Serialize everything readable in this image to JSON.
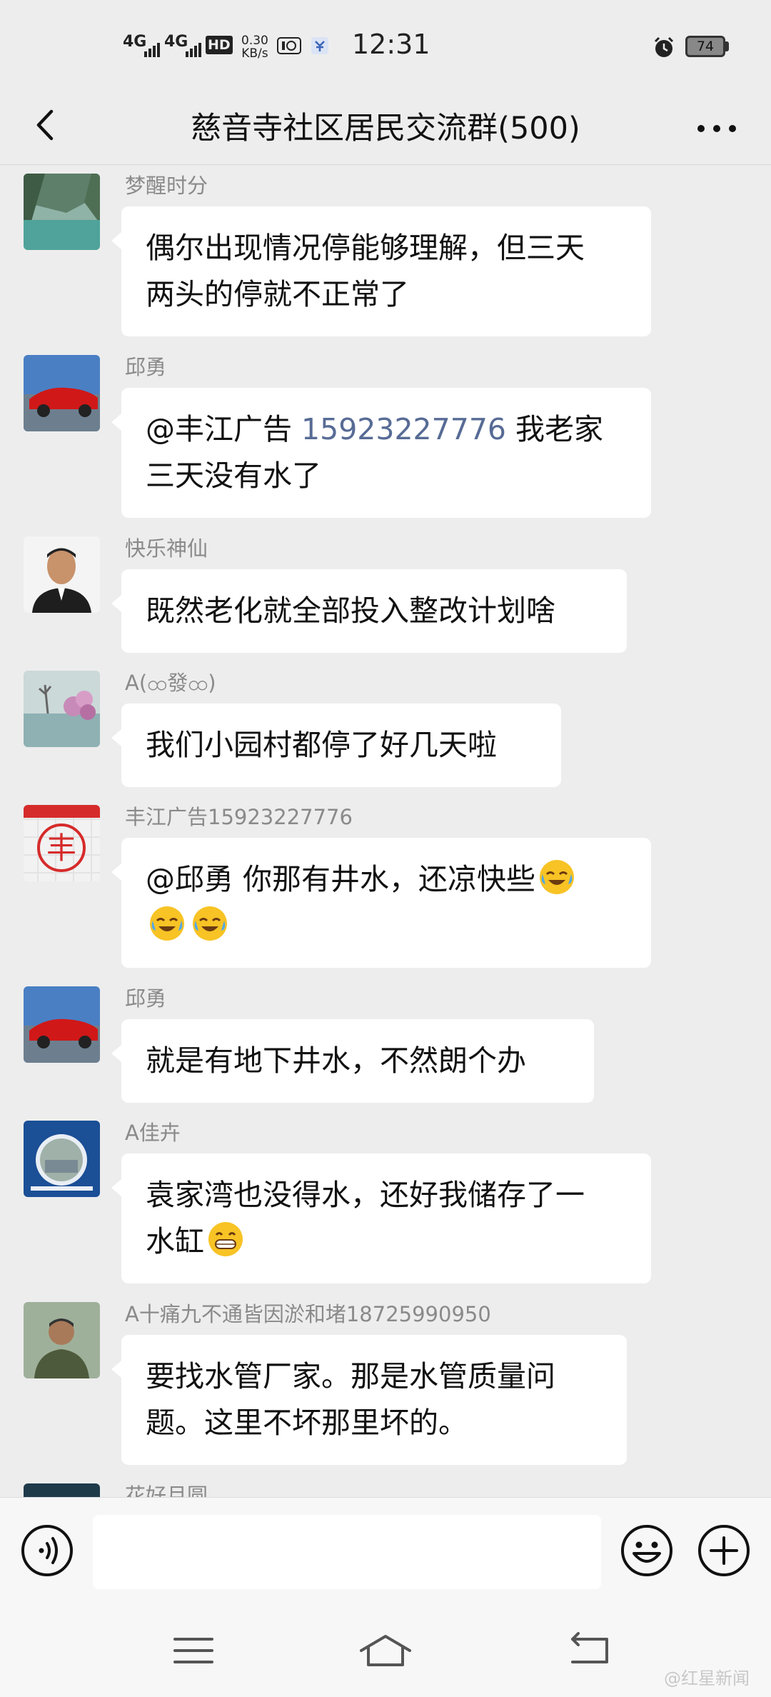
{
  "status_bar": {
    "net1": "4G",
    "net2": "4G",
    "hd": "HD",
    "speed_value": "0.30",
    "speed_unit": "KB/s",
    "time": "12:31",
    "battery": "74"
  },
  "header": {
    "title": "慈音寺社区居民交流群(500)"
  },
  "messages": [
    {
      "sender": "梦醒时分",
      "lines": [
        "偶尔出现情况停能够理解，但三天",
        "两头的停就不正常了"
      ]
    },
    {
      "sender": "邱勇",
      "mention": "@丰江广告",
      "phone": "15923227776",
      "rest1": " 我老家",
      "line2": "三天没有水了"
    },
    {
      "sender": "快乐神仙",
      "lines": [
        "既然老化就全部投入整改计划啥"
      ]
    },
    {
      "sender": "A(ထ發ထ)",
      "lines": [
        "我们小园村都停了好几天啦"
      ]
    },
    {
      "sender": "丰江广告15923227776",
      "line1": "@邱勇  你那有井水，还凉快些"
    },
    {
      "sender": "邱勇",
      "lines": [
        "就是有地下井水，不然朗个办"
      ]
    },
    {
      "sender": "A佳卉",
      "line1": "袁家湾也没得水，还好我储存了一",
      "line2": "水缸"
    },
    {
      "sender": "A十痛九不通皆因淤和堵18725990950",
      "lines": [
        "要找水管厂家。那是水管质量问",
        "题。这里不坏那里坏的。"
      ]
    },
    {
      "sender": "花好月圆"
    }
  ],
  "icons": {
    "back": "chevron-left-icon",
    "more": "more-dots-icon",
    "voice": "voice-icon",
    "emoji": "emoji-icon",
    "plus": "plus-icon"
  },
  "watermark": "@红星新闻"
}
